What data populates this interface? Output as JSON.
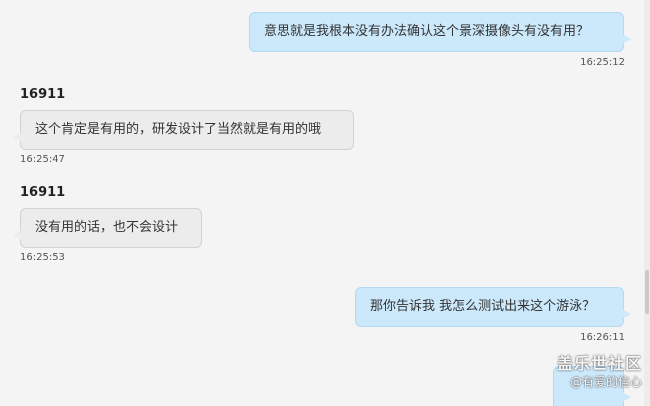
{
  "messages": [
    {
      "dir": "out",
      "text": "意思就是我根本没有办法确认这个景深摄像头有没有用？",
      "time": "16:25:12"
    },
    {
      "dir": "in",
      "sender": "16911",
      "text": "这个肯定是有用的，研发设计了当然就是有用的哦",
      "time": "16:25:47"
    },
    {
      "dir": "in",
      "sender": "16911",
      "text": "没有用的话，也不会设计",
      "time": "16:25:53"
    },
    {
      "dir": "out",
      "text": "那你告诉我 我怎么测试出来这个游泳？",
      "time": "16:26:11"
    }
  ],
  "watermark": {
    "title": "盖乐世社区",
    "sub": "@有爱的信心"
  },
  "colors": {
    "outgoing_bubble": "#cce8fb",
    "incoming_bubble": "#ececec",
    "background": "#f4f4f4"
  }
}
